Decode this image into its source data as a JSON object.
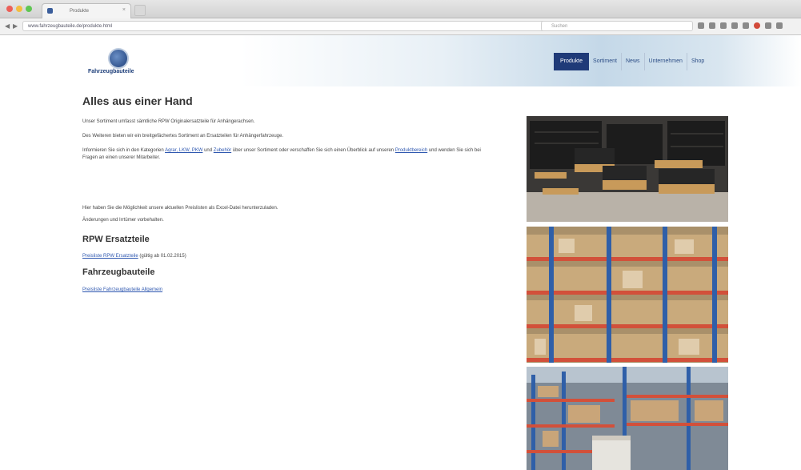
{
  "browser": {
    "tab_title": "Produkte",
    "tab_close": "×",
    "back": "◀",
    "forward": "▶",
    "url": "www.fahrzeugbauteile.de/produkte.html",
    "search_placeholder": "Suchen"
  },
  "site": {
    "logo_text": "Fahrzeugbauteile",
    "nav": [
      "Produkte",
      "Sortiment",
      "News",
      "Unternehmen",
      "Shop"
    ]
  },
  "content": {
    "title": "Alles aus einer Hand",
    "p1": "Unser Sortiment umfasst sämtliche RPW Originalersatzteile für Anhängerachsen.",
    "p2": "Des Weiteren bieten wir ein breitgefächertes Sortiment an Ersatzteilen für Anhängerfahrzeuge.",
    "p3_pre": "Informieren Sie sich in den Kategorien ",
    "p3_link1": "Agrar, LKW, PKW",
    "p3_mid1": " und ",
    "p3_link2": "Zubehör",
    "p3_mid2": " über unser Sortiment oder verschaffen Sie sich einen Überblick auf unseren ",
    "p3_link3": "Produktbereich",
    "p3_post": " und wenden Sie sich bei Fragen an einen unserer Mitarbeiter.",
    "p4": "Hier haben Sie die Möglichkeit unsere aktuellen Preislisten als Excel-Datei herunterzuladen.",
    "p5": "Änderungen und Irrtümer vorbehalten.",
    "h_rpw": "RPW Ersatzteile",
    "link_rpw": "Preisliste RPW Ersatzteile",
    "link_rpw_note": " (gültig ab 01.02.2015)",
    "h_fzb": "Fahrzeugbauteile",
    "link_fzb": "Preisliste Fahrzeugbauteile Allgemein"
  }
}
